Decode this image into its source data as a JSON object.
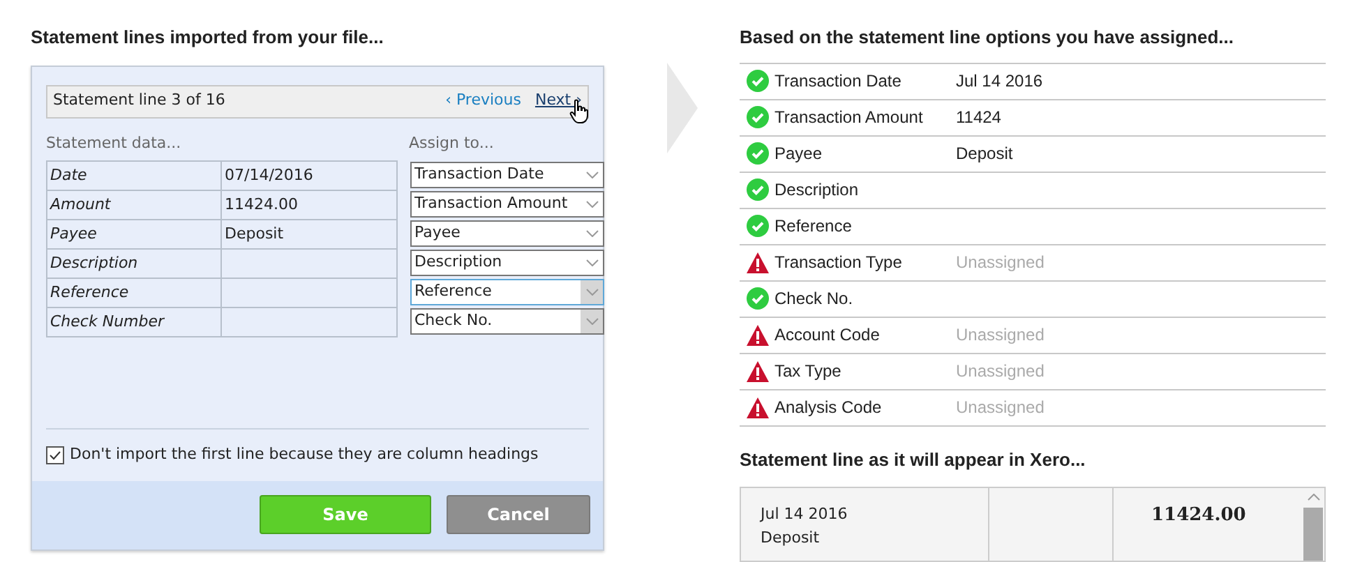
{
  "left": {
    "heading": "Statement lines imported from your file...",
    "pager": {
      "label": "Statement line 3 of 16",
      "previous": "‹ Previous",
      "next": "Next ›"
    },
    "data_heading": "Statement data...",
    "assign_heading": "Assign to...",
    "rows": [
      {
        "field": "Date",
        "value": "07/14/2016",
        "assign": "Transaction Date",
        "active": false,
        "focused": false
      },
      {
        "field": "Amount",
        "value": "11424.00",
        "assign": "Transaction Amount",
        "active": false,
        "focused": false
      },
      {
        "field": "Payee",
        "value": "Deposit",
        "assign": "Payee",
        "active": false,
        "focused": false
      },
      {
        "field": "Description",
        "assign": "Description",
        "active": false,
        "focused": false
      },
      {
        "field": "Reference",
        "assign": "Reference",
        "active": true,
        "focused": true
      },
      {
        "field": "Check Number",
        "assign": "Check No.",
        "active": true,
        "focused": false
      }
    ],
    "skip_first": {
      "label": "Don't import the first line because they are column headings",
      "checked": true
    },
    "buttons": [
      {
        "label": "Save",
        "kind": "primary"
      },
      {
        "label": "Cancel",
        "kind": "secondary"
      }
    ]
  },
  "right": {
    "heading": "Based on the statement line options you have assigned...",
    "rows": [
      {
        "label": "Transaction Date",
        "kind": "ok",
        "value": "Jul 14 2016"
      },
      {
        "label": "Transaction Amount",
        "kind": "ok",
        "value": "11424"
      },
      {
        "label": "Payee",
        "kind": "ok",
        "value": "Deposit"
      },
      {
        "label": "Description",
        "kind": "ok"
      },
      {
        "label": "Reference",
        "kind": "ok"
      },
      {
        "label": "Transaction Type",
        "kind": "warning",
        "value": "Unassigned"
      },
      {
        "label": "Check No.",
        "kind": "ok"
      },
      {
        "label": "Account Code",
        "kind": "warning",
        "value": "Unassigned"
      },
      {
        "label": "Tax Type",
        "kind": "warning",
        "value": "Unassigned"
      },
      {
        "label": "Analysis Code",
        "kind": "warning",
        "value": "Unassigned"
      }
    ],
    "preview_heading": "Statement line as it will appear in Xero...",
    "preview": {
      "date": "Jul 14 2016",
      "payee": "Deposit",
      "amount": "11424.00"
    }
  }
}
